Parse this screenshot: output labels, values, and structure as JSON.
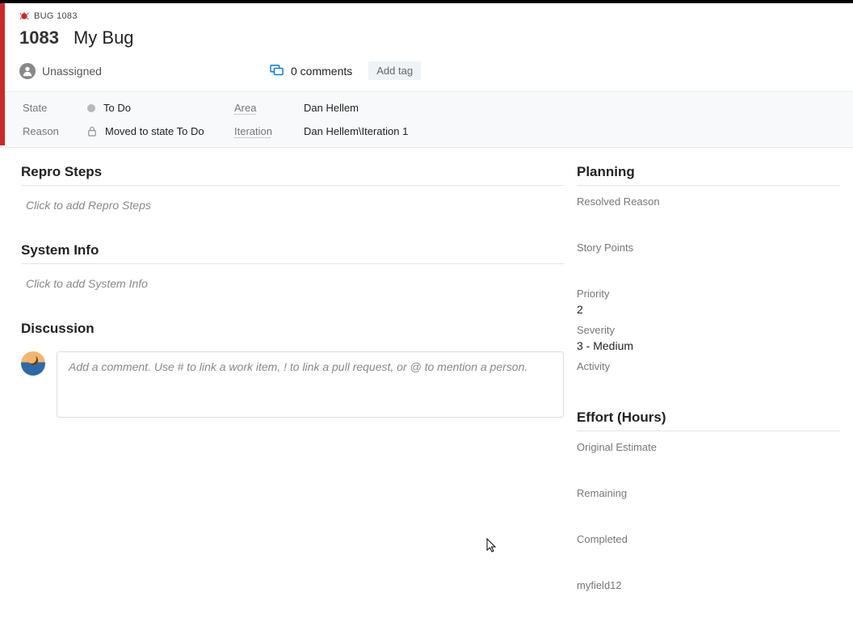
{
  "header": {
    "breadcrumb": "BUG 1083",
    "id": "1083",
    "title": "My Bug",
    "assignee": "Unassigned",
    "comments_label": "0 comments",
    "add_tag_label": "Add tag"
  },
  "fields": {
    "state_label": "State",
    "state_value": "To Do",
    "reason_label": "Reason",
    "reason_value": "Moved to state To Do",
    "area_label": "Area",
    "area_value": "Dan Hellem",
    "iteration_label": "Iteration",
    "iteration_value": "Dan Hellem\\Iteration 1"
  },
  "sections": {
    "repro_h": "Repro Steps",
    "repro_placeholder": "Click to add Repro Steps",
    "sysinfo_h": "System Info",
    "sysinfo_placeholder": "Click to add System Info",
    "discussion_h": "Discussion",
    "comment_placeholder": "Add a comment. Use # to link a work item, ! to link a pull request, or @ to mention a person."
  },
  "planning": {
    "heading": "Planning",
    "resolved_reason_label": "Resolved Reason",
    "resolved_reason_value": "",
    "story_points_label": "Story Points",
    "story_points_value": "",
    "priority_label": "Priority",
    "priority_value": "2",
    "severity_label": "Severity",
    "severity_value": "3 - Medium",
    "activity_label": "Activity",
    "activity_value": ""
  },
  "effort": {
    "heading": "Effort (Hours)",
    "original_label": "Original Estimate",
    "original_value": "",
    "remaining_label": "Remaining",
    "remaining_value": "",
    "completed_label": "Completed",
    "completed_value": "",
    "custom_label": "myfield12",
    "custom_value": ""
  }
}
